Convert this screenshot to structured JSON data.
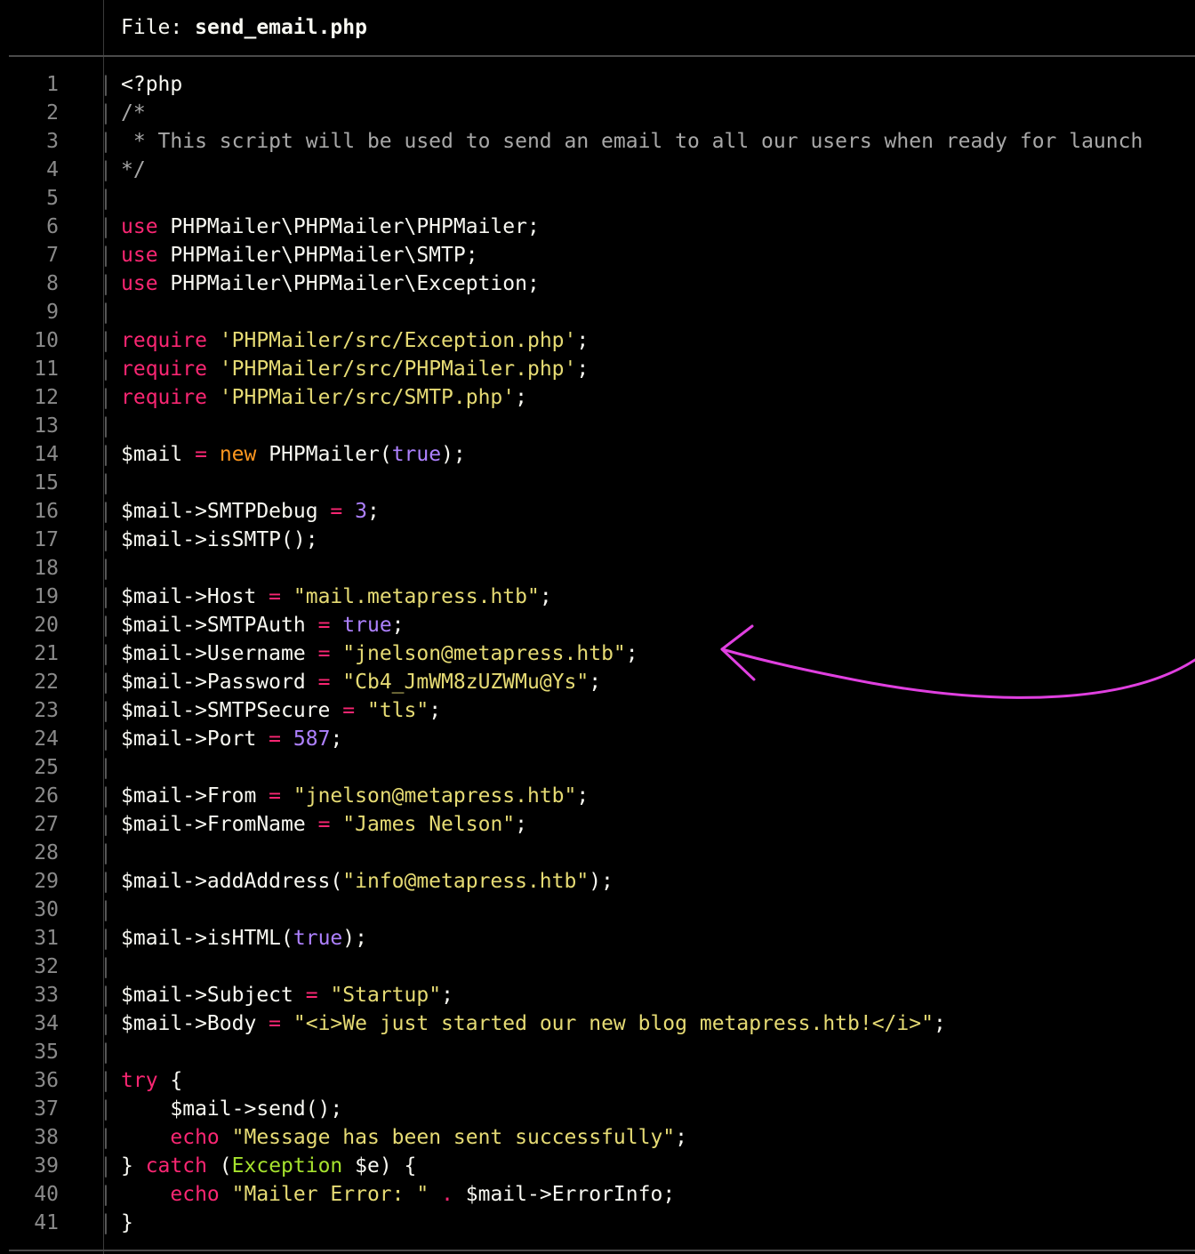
{
  "header": {
    "file_label": "File: ",
    "file_name": "send_email.php"
  },
  "colors": {
    "background": "#000000",
    "keyword": "#f92672",
    "string": "#e6db74",
    "comment": "#a8a8a8",
    "number_bool": "#ae81ff",
    "class": "#a6e22e",
    "annotation": "#e040e0"
  },
  "annotation": {
    "type": "hand-drawn-arrow",
    "points_to_line": 21
  },
  "lines": [
    {
      "n": "1",
      "tokens": [
        {
          "t": "<?php",
          "c": "plain"
        }
      ]
    },
    {
      "n": "2",
      "tokens": [
        {
          "t": "/*",
          "c": "cmt"
        }
      ]
    },
    {
      "n": "3",
      "tokens": [
        {
          "t": " * This script will be used to send an email to all our users when ready for launch",
          "c": "cmt"
        }
      ]
    },
    {
      "n": "4",
      "tokens": [
        {
          "t": "*/",
          "c": "cmt"
        }
      ]
    },
    {
      "n": "5",
      "tokens": []
    },
    {
      "n": "6",
      "tokens": [
        {
          "t": "use",
          "c": "kw"
        },
        {
          "t": " PHPMailer\\PHPMailer\\PHPMailer;",
          "c": "plain"
        }
      ]
    },
    {
      "n": "7",
      "tokens": [
        {
          "t": "use",
          "c": "kw"
        },
        {
          "t": " PHPMailer\\PHPMailer\\SMTP;",
          "c": "plain"
        }
      ]
    },
    {
      "n": "8",
      "tokens": [
        {
          "t": "use",
          "c": "kw"
        },
        {
          "t": " PHPMailer\\PHPMailer\\Exception;",
          "c": "plain"
        }
      ]
    },
    {
      "n": "9",
      "tokens": []
    },
    {
      "n": "10",
      "tokens": [
        {
          "t": "require",
          "c": "kw"
        },
        {
          "t": " ",
          "c": "plain"
        },
        {
          "t": "'PHPMailer/src/Exception.php'",
          "c": "str"
        },
        {
          "t": ";",
          "c": "plain"
        }
      ]
    },
    {
      "n": "11",
      "tokens": [
        {
          "t": "require",
          "c": "kw"
        },
        {
          "t": " ",
          "c": "plain"
        },
        {
          "t": "'PHPMailer/src/PHPMailer.php'",
          "c": "str"
        },
        {
          "t": ";",
          "c": "plain"
        }
      ]
    },
    {
      "n": "12",
      "tokens": [
        {
          "t": "require",
          "c": "kw"
        },
        {
          "t": " ",
          "c": "plain"
        },
        {
          "t": "'PHPMailer/src/SMTP.php'",
          "c": "str"
        },
        {
          "t": ";",
          "c": "plain"
        }
      ]
    },
    {
      "n": "13",
      "tokens": []
    },
    {
      "n": "14",
      "tokens": [
        {
          "t": "$mail ",
          "c": "plain"
        },
        {
          "t": "=",
          "c": "op"
        },
        {
          "t": " ",
          "c": "plain"
        },
        {
          "t": "new",
          "c": "kw2"
        },
        {
          "t": " PHPMailer(",
          "c": "plain"
        },
        {
          "t": "true",
          "c": "num"
        },
        {
          "t": ");",
          "c": "plain"
        }
      ]
    },
    {
      "n": "15",
      "tokens": []
    },
    {
      "n": "16",
      "tokens": [
        {
          "t": "$mail->SMTPDebug ",
          "c": "plain"
        },
        {
          "t": "=",
          "c": "op"
        },
        {
          "t": " ",
          "c": "plain"
        },
        {
          "t": "3",
          "c": "num"
        },
        {
          "t": ";",
          "c": "plain"
        }
      ]
    },
    {
      "n": "17",
      "tokens": [
        {
          "t": "$mail->isSMTP();",
          "c": "plain"
        }
      ]
    },
    {
      "n": "18",
      "tokens": []
    },
    {
      "n": "19",
      "tokens": [
        {
          "t": "$mail->Host ",
          "c": "plain"
        },
        {
          "t": "=",
          "c": "op"
        },
        {
          "t": " ",
          "c": "plain"
        },
        {
          "t": "\"mail.metapress.htb\"",
          "c": "str"
        },
        {
          "t": ";",
          "c": "plain"
        }
      ]
    },
    {
      "n": "20",
      "tokens": [
        {
          "t": "$mail->SMTPAuth ",
          "c": "plain"
        },
        {
          "t": "=",
          "c": "op"
        },
        {
          "t": " ",
          "c": "plain"
        },
        {
          "t": "true",
          "c": "num"
        },
        {
          "t": ";",
          "c": "plain"
        }
      ]
    },
    {
      "n": "21",
      "tokens": [
        {
          "t": "$mail->Username ",
          "c": "plain"
        },
        {
          "t": "=",
          "c": "op"
        },
        {
          "t": " ",
          "c": "plain"
        },
        {
          "t": "\"jnelson@metapress.htb\"",
          "c": "str"
        },
        {
          "t": ";",
          "c": "plain"
        }
      ]
    },
    {
      "n": "22",
      "tokens": [
        {
          "t": "$mail->Password ",
          "c": "plain"
        },
        {
          "t": "=",
          "c": "op"
        },
        {
          "t": " ",
          "c": "plain"
        },
        {
          "t": "\"Cb4_JmWM8zUZWMu@Ys\"",
          "c": "str"
        },
        {
          "t": ";",
          "c": "plain"
        }
      ]
    },
    {
      "n": "23",
      "tokens": [
        {
          "t": "$mail->SMTPSecure ",
          "c": "plain"
        },
        {
          "t": "=",
          "c": "op"
        },
        {
          "t": " ",
          "c": "plain"
        },
        {
          "t": "\"tls\"",
          "c": "str"
        },
        {
          "t": ";",
          "c": "plain"
        }
      ]
    },
    {
      "n": "24",
      "tokens": [
        {
          "t": "$mail->Port ",
          "c": "plain"
        },
        {
          "t": "=",
          "c": "op"
        },
        {
          "t": " ",
          "c": "plain"
        },
        {
          "t": "587",
          "c": "num"
        },
        {
          "t": ";",
          "c": "plain"
        }
      ]
    },
    {
      "n": "25",
      "tokens": []
    },
    {
      "n": "26",
      "tokens": [
        {
          "t": "$mail->From ",
          "c": "plain"
        },
        {
          "t": "=",
          "c": "op"
        },
        {
          "t": " ",
          "c": "plain"
        },
        {
          "t": "\"jnelson@metapress.htb\"",
          "c": "str"
        },
        {
          "t": ";",
          "c": "plain"
        }
      ]
    },
    {
      "n": "27",
      "tokens": [
        {
          "t": "$mail->FromName ",
          "c": "plain"
        },
        {
          "t": "=",
          "c": "op"
        },
        {
          "t": " ",
          "c": "plain"
        },
        {
          "t": "\"James Nelson\"",
          "c": "str"
        },
        {
          "t": ";",
          "c": "plain"
        }
      ]
    },
    {
      "n": "28",
      "tokens": []
    },
    {
      "n": "29",
      "tokens": [
        {
          "t": "$mail->addAddress(",
          "c": "plain"
        },
        {
          "t": "\"info@metapress.htb\"",
          "c": "str"
        },
        {
          "t": ");",
          "c": "plain"
        }
      ]
    },
    {
      "n": "30",
      "tokens": []
    },
    {
      "n": "31",
      "tokens": [
        {
          "t": "$mail->isHTML(",
          "c": "plain"
        },
        {
          "t": "true",
          "c": "num"
        },
        {
          "t": ");",
          "c": "plain"
        }
      ]
    },
    {
      "n": "32",
      "tokens": []
    },
    {
      "n": "33",
      "tokens": [
        {
          "t": "$mail->Subject ",
          "c": "plain"
        },
        {
          "t": "=",
          "c": "op"
        },
        {
          "t": " ",
          "c": "plain"
        },
        {
          "t": "\"Startup\"",
          "c": "str"
        },
        {
          "t": ";",
          "c": "plain"
        }
      ]
    },
    {
      "n": "34",
      "tokens": [
        {
          "t": "$mail->Body ",
          "c": "plain"
        },
        {
          "t": "=",
          "c": "op"
        },
        {
          "t": " ",
          "c": "plain"
        },
        {
          "t": "\"<i>We just started our new blog metapress.htb!</i>\"",
          "c": "str"
        },
        {
          "t": ";",
          "c": "plain"
        }
      ]
    },
    {
      "n": "35",
      "tokens": []
    },
    {
      "n": "36",
      "tokens": [
        {
          "t": "try",
          "c": "kw"
        },
        {
          "t": " {",
          "c": "plain"
        }
      ]
    },
    {
      "n": "37",
      "tokens": [
        {
          "t": "    $mail->send();",
          "c": "plain"
        }
      ]
    },
    {
      "n": "38",
      "tokens": [
        {
          "t": "    ",
          "c": "plain"
        },
        {
          "t": "echo",
          "c": "kw"
        },
        {
          "t": " ",
          "c": "plain"
        },
        {
          "t": "\"Message has been sent successfully\"",
          "c": "str"
        },
        {
          "t": ";",
          "c": "plain"
        }
      ]
    },
    {
      "n": "39",
      "tokens": [
        {
          "t": "} ",
          "c": "plain"
        },
        {
          "t": "catch",
          "c": "kw"
        },
        {
          "t": " (",
          "c": "plain"
        },
        {
          "t": "Exception",
          "c": "cls"
        },
        {
          "t": " $e) {",
          "c": "plain"
        }
      ]
    },
    {
      "n": "40",
      "tokens": [
        {
          "t": "    ",
          "c": "plain"
        },
        {
          "t": "echo",
          "c": "kw"
        },
        {
          "t": " ",
          "c": "plain"
        },
        {
          "t": "\"Mailer Error: \"",
          "c": "str"
        },
        {
          "t": " ",
          "c": "plain"
        },
        {
          "t": ".",
          "c": "op"
        },
        {
          "t": " $mail->ErrorInfo;",
          "c": "plain"
        }
      ]
    },
    {
      "n": "41",
      "tokens": [
        {
          "t": "}",
          "c": "plain"
        }
      ]
    }
  ]
}
